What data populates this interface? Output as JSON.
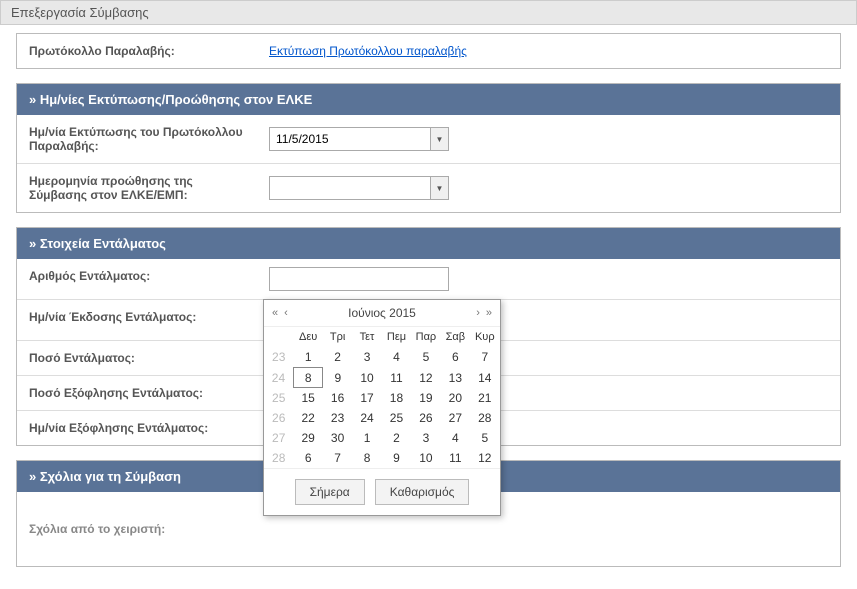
{
  "page_title": "Επεξεργασία Σύμβασης",
  "protocol": {
    "label": "Πρωτόκολλο Παραλαβής:",
    "link_text": "Εκτύπωση Πρωτόκολλου παραλαβής"
  },
  "elke": {
    "header": "» Ημ/νίες Εκτύπωσης/Προώθησης στον ΕΛΚΕ",
    "print_date_label": "Ημ/νία Εκτύπωσης του Πρωτόκολλου Παραλαβής:",
    "print_date_value": "11/5/2015",
    "forward_date_label": "Ημερομηνία προώθησης της Σύμβασης στον ΕΛΚΕ/ΕΜΠ:",
    "forward_date_value": ""
  },
  "warrant": {
    "header": "» Στοιχεία Εντάλματος",
    "number_label": "Αριθμός Εντάλματος:",
    "number_value": "",
    "issue_date_label": "Ημ/νία Έκδοσης Εντάλματος:",
    "issue_date_value": "",
    "amount_label": "Ποσό Εντάλματος:",
    "paid_amount_label": "Ποσό Εξόφλησης Εντάλματος:",
    "paid_date_label": "Ημ/νία Εξόφλησης Εντάλματος:"
  },
  "comments": {
    "header": "» Σχόλια για τη Σύμβαση",
    "operator_label": "Σχόλια από το χειριστή:"
  },
  "datepicker": {
    "title": "Ιούνιος 2015",
    "nav_prev_year": "«",
    "nav_prev_month": "‹",
    "nav_next_month": "›",
    "nav_next_year": "»",
    "weekdays": [
      "Δευ",
      "Τρι",
      "Τετ",
      "Πεμ",
      "Παρ",
      "Σαβ",
      "Κυρ"
    ],
    "weeks": [
      {
        "wk": "23",
        "days": [
          {
            "d": "1"
          },
          {
            "d": "2"
          },
          {
            "d": "3"
          },
          {
            "d": "4"
          },
          {
            "d": "5"
          },
          {
            "d": "6",
            "we": true
          },
          {
            "d": "7",
            "we": true
          }
        ]
      },
      {
        "wk": "24",
        "days": [
          {
            "d": "8",
            "today": true
          },
          {
            "d": "9"
          },
          {
            "d": "10"
          },
          {
            "d": "11"
          },
          {
            "d": "12"
          },
          {
            "d": "13",
            "we": true
          },
          {
            "d": "14",
            "we": true
          }
        ]
      },
      {
        "wk": "25",
        "days": [
          {
            "d": "15"
          },
          {
            "d": "16"
          },
          {
            "d": "17"
          },
          {
            "d": "18"
          },
          {
            "d": "19"
          },
          {
            "d": "20",
            "we": true
          },
          {
            "d": "21",
            "we": true
          }
        ]
      },
      {
        "wk": "26",
        "days": [
          {
            "d": "22"
          },
          {
            "d": "23"
          },
          {
            "d": "24"
          },
          {
            "d": "25"
          },
          {
            "d": "26"
          },
          {
            "d": "27",
            "we": true
          },
          {
            "d": "28",
            "we": true
          }
        ]
      },
      {
        "wk": "27",
        "days": [
          {
            "d": "29"
          },
          {
            "d": "30"
          },
          {
            "d": "1",
            "other": true
          },
          {
            "d": "2",
            "other": true
          },
          {
            "d": "3",
            "other": true
          },
          {
            "d": "4",
            "other": true
          },
          {
            "d": "5",
            "other": true
          }
        ]
      },
      {
        "wk": "28",
        "days": [
          {
            "d": "6",
            "other": true
          },
          {
            "d": "7",
            "other": true
          },
          {
            "d": "8",
            "other": true
          },
          {
            "d": "9",
            "other": true
          },
          {
            "d": "10",
            "other": true
          },
          {
            "d": "11",
            "other": true
          },
          {
            "d": "12",
            "other": true
          }
        ]
      }
    ],
    "today_btn": "Σήμερα",
    "clear_btn": "Καθαρισμός",
    "error_mark": "!"
  }
}
